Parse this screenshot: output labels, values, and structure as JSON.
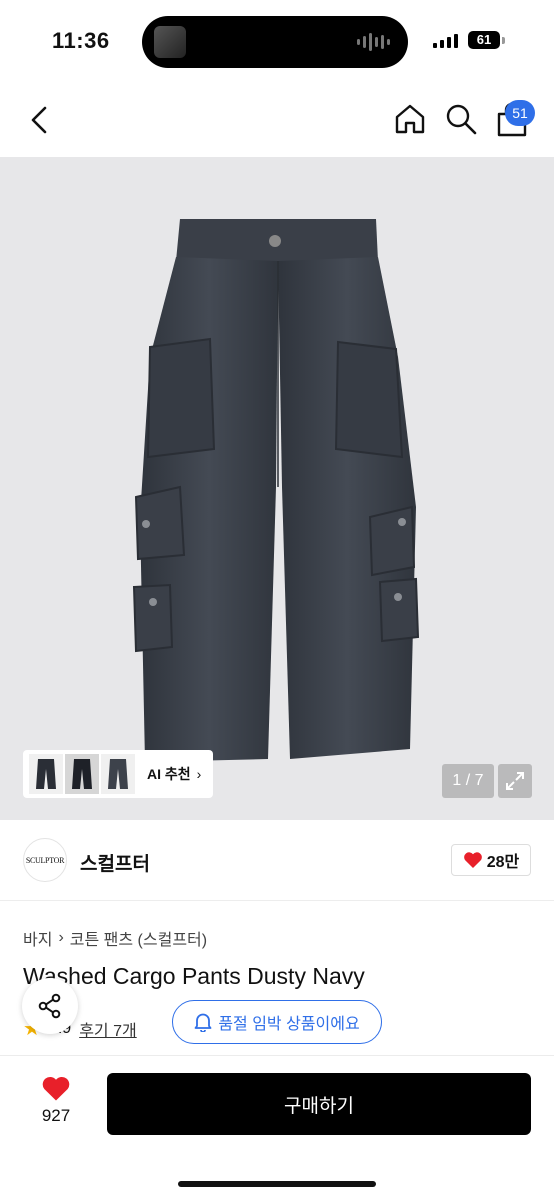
{
  "status_bar": {
    "time": "11:36",
    "battery": "61"
  },
  "icons": {
    "back": "chevron-left-icon",
    "home": "home-icon",
    "search": "search-icon",
    "cart": "shopping-bag-icon",
    "share": "share-icon",
    "heart": "heart-icon",
    "bell": "bell-icon",
    "expand": "expand-icon",
    "star": "star-icon"
  },
  "nav": {
    "cart_count": "51"
  },
  "gallery": {
    "ai_label": "AI 추천",
    "ai_chevron": "›",
    "counter": "1 / 7"
  },
  "shop": {
    "logo_text": "SCULPTOR",
    "name": "스컬프터",
    "likes": "28만"
  },
  "breadcrumb": {
    "level1": "바지",
    "separator": "›",
    "level2": "코튼 팬츠 (스컬프터)"
  },
  "product": {
    "title": "Washed Cargo Pants Dusty Navy",
    "rating": "4.9",
    "reviews": "후기 7개",
    "soldout_notice": "품절 임박 상품이에요"
  },
  "bottom": {
    "wish_count": "927",
    "buy_label": "구매하기"
  },
  "colors": {
    "accent": "#2f6fe8",
    "heart": "#e8202a",
    "pants": "#3a3f48",
    "buy_button": "#000000"
  }
}
